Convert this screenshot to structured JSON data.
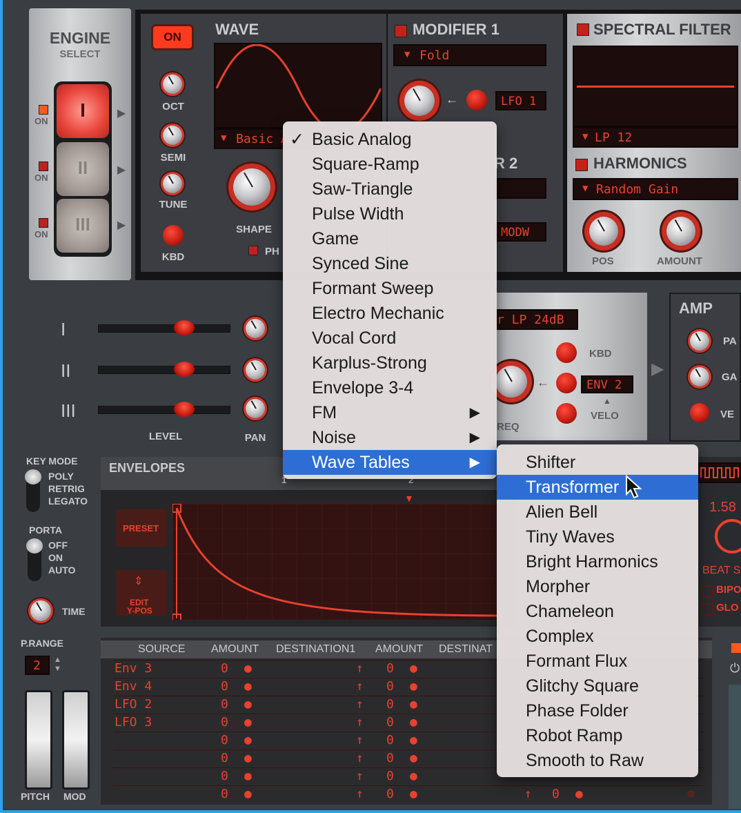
{
  "engine": {
    "title": "ENGINE",
    "subtitle": "SELECT",
    "slots": [
      {
        "label": "I",
        "on": "ON"
      },
      {
        "label": "II",
        "on": "ON"
      },
      {
        "label": "III",
        "on": "ON"
      }
    ]
  },
  "osc": {
    "on_button": "ON",
    "wave_title": "WAVE",
    "wave_select": "Basic An",
    "knobs": [
      "OCT",
      "SEMI",
      "TUNE",
      "KBD"
    ],
    "shape_label": "SHAPE",
    "ph_label": "PH"
  },
  "modifier1": {
    "title": "MODIFIER 1",
    "select": "Fold",
    "source": "LFO 1"
  },
  "modifier2": {
    "title_partial": "R 2",
    "source": "MODW"
  },
  "spectral": {
    "title": "SPECTRAL FILTER",
    "select": "LP 12"
  },
  "harmonics": {
    "title": "HARMONICS",
    "select": "Random Gain",
    "knobs": [
      "POS",
      "AMOUNT"
    ]
  },
  "mixer": {
    "rows": [
      "I",
      "II",
      "III"
    ],
    "level_label": "LEVEL",
    "pan_label": "PAN"
  },
  "filter": {
    "type": "r LP 24dB",
    "freq_label": "REQ",
    "kbd_label": "KBD",
    "env_source": "ENV 2",
    "velo_label": "VELO"
  },
  "amp": {
    "title": "AMP",
    "labels": [
      "PA",
      "GA",
      "VE"
    ]
  },
  "keymode": {
    "title": "KEY MODE",
    "options": [
      "POLY",
      "RETRIG",
      "LEGATO"
    ]
  },
  "porta": {
    "title": "PORTA",
    "options": [
      "OFF",
      "ON",
      "AUTO"
    ],
    "time_label": "TIME"
  },
  "prange": {
    "title": "P.RANGE",
    "value": "2"
  },
  "wheels": {
    "pitch": "PITCH",
    "mod": "MOD"
  },
  "envelopes": {
    "title": "ENVELOPES",
    "preset_label": "PRESET",
    "edit_label": "EDIT",
    "ypos_label": "Y-POS",
    "tab1": "1",
    "tab2": "2"
  },
  "lfo": {
    "value": "1.58",
    "beat": "BEAT S",
    "bipo": "BIPO",
    "glo": "GLO"
  },
  "mod_matrix": {
    "headers": [
      "SOURCE",
      "AMOUNT",
      "DESTINATION1",
      "AMOUNT",
      "DESTINAT"
    ],
    "rows": [
      {
        "source": "Env 3",
        "amount": "0",
        "amount2": "0"
      },
      {
        "source": "Env 4",
        "amount": "0",
        "amount2": "0"
      },
      {
        "source": "LFO 2",
        "amount": "0",
        "amount2": "0"
      },
      {
        "source": "LFO 3",
        "amount": "0",
        "amount2": "0"
      },
      {
        "source": "",
        "amount": "0",
        "amount2": "0"
      },
      {
        "source": "",
        "amount": "0",
        "amount2": "0"
      },
      {
        "source": "",
        "amount": "0",
        "amount2": "0"
      },
      {
        "source": "",
        "amount": "0",
        "amount2": "0",
        "amount3": "0"
      }
    ]
  },
  "wave_menu": {
    "items": [
      {
        "label": "Basic Analog",
        "checked": true,
        "submenu": false
      },
      {
        "label": "Square-Ramp",
        "submenu": false
      },
      {
        "label": "Saw-Triangle",
        "submenu": false
      },
      {
        "label": "Pulse Width",
        "submenu": false
      },
      {
        "label": "Game",
        "submenu": false
      },
      {
        "label": "Synced Sine",
        "submenu": false
      },
      {
        "label": "Formant Sweep",
        "submenu": false
      },
      {
        "label": "Electro Mechanic",
        "submenu": false
      },
      {
        "label": "Vocal Cord",
        "submenu": false
      },
      {
        "label": "Karplus-Strong",
        "submenu": false
      },
      {
        "label": "Envelope 3-4",
        "submenu": false
      },
      {
        "label": "FM",
        "submenu": true
      },
      {
        "label": "Noise",
        "submenu": true
      },
      {
        "label": "Wave Tables",
        "submenu": true,
        "selected": true
      }
    ],
    "check_glyph": "✓",
    "arrow_glyph": "▶"
  },
  "wavetable_submenu": {
    "items": [
      "Shifter",
      "Transformer",
      "Alien Bell",
      "Tiny Waves",
      "Bright Harmonics",
      "Morpher",
      "Chameleon",
      "Complex",
      "Formant Flux",
      "Glitchy Square",
      "Phase Folder",
      "Robot Ramp",
      "Smooth to Raw"
    ],
    "highlighted": "Transformer"
  },
  "colors": {
    "accent_red": "#e8412f",
    "menu_highlight": "#2e6ed4",
    "frame_blue": "#2aa4e8"
  }
}
